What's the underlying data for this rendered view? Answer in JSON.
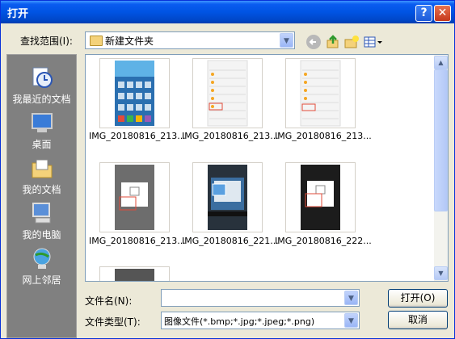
{
  "window": {
    "title": "打开",
    "help_glyph": "?",
    "close_glyph": "✕"
  },
  "lookin": {
    "label": "查找范围(I):",
    "value": "新建文件夹"
  },
  "places": [
    {
      "label": "我最近的文档",
      "icon": "recent-docs-icon"
    },
    {
      "label": "桌面",
      "icon": "desktop-icon"
    },
    {
      "label": "我的文档",
      "icon": "my-documents-icon"
    },
    {
      "label": "我的电脑",
      "icon": "my-computer-icon"
    },
    {
      "label": "网上邻居",
      "icon": "network-places-icon"
    }
  ],
  "files": [
    {
      "name": "IMG_20180816_213..."
    },
    {
      "name": "IMG_20180816_213..."
    },
    {
      "name": "IMG_20180816_213..."
    },
    {
      "name": "IMG_20180816_213..."
    },
    {
      "name": "IMG_20180816_221..."
    },
    {
      "name": "IMG_20180816_222..."
    }
  ],
  "filename": {
    "label": "文件名(N):",
    "value": ""
  },
  "filetype": {
    "label": "文件类型(T):",
    "value": "图像文件(*.bmp;*.jpg;*.jpeg;*.png)"
  },
  "buttons": {
    "open": "打开(O)",
    "cancel": "取消"
  }
}
